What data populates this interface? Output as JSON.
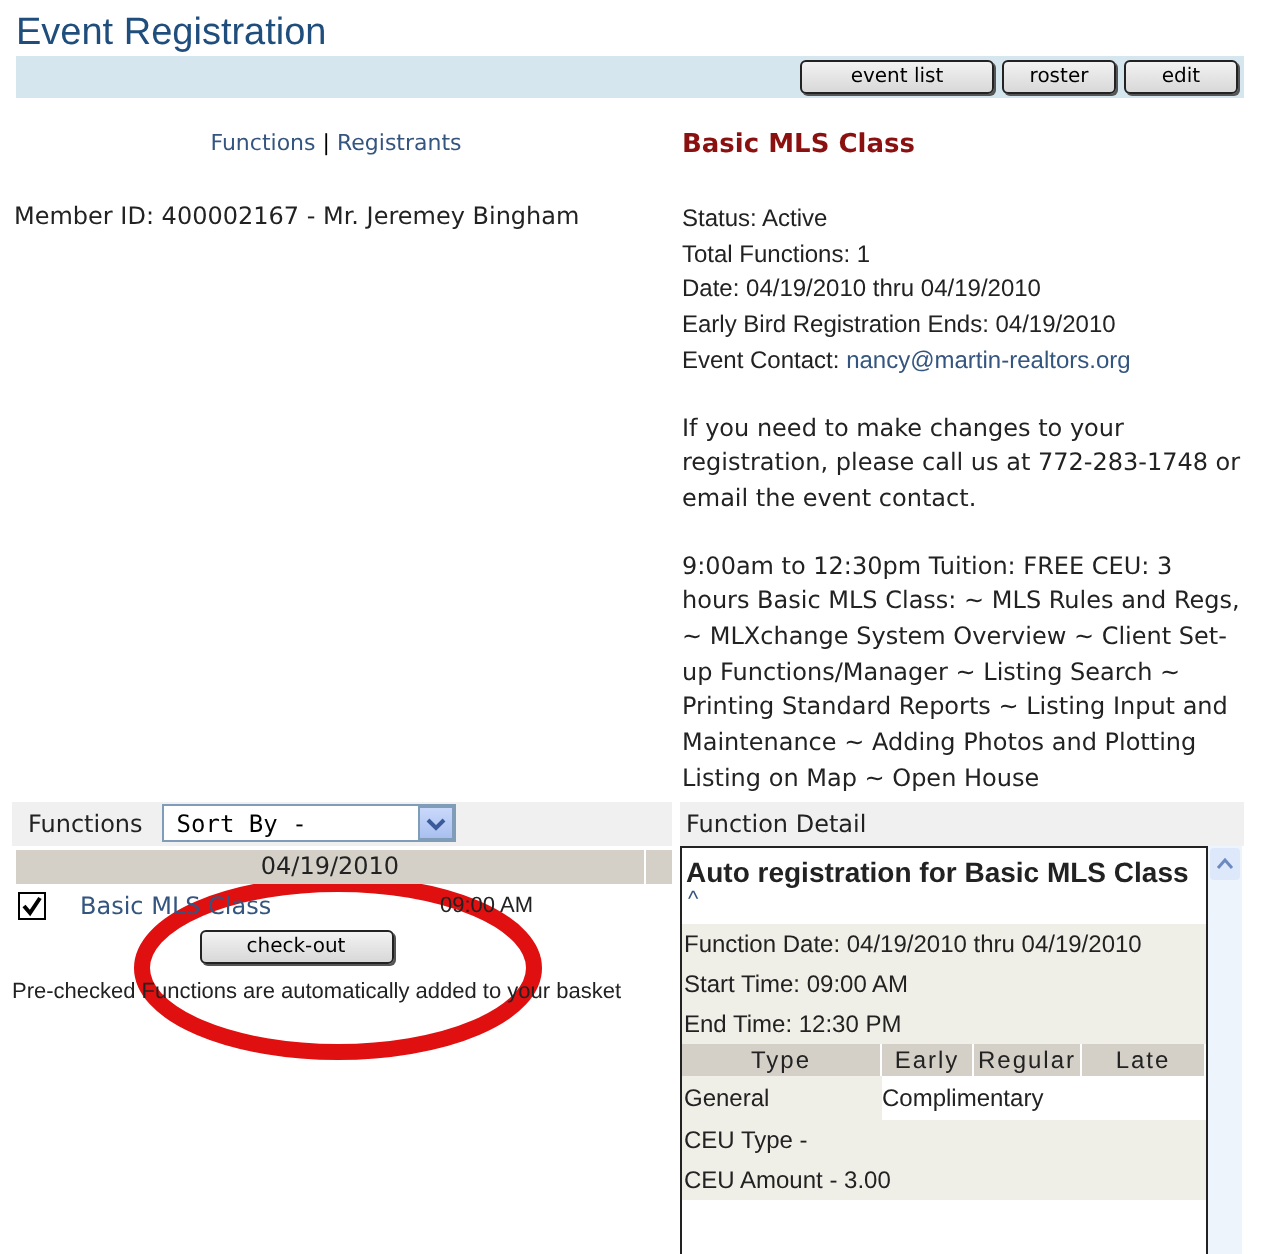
{
  "title": "Event Registration",
  "toolbar": {
    "buttons": [
      "event list",
      "roster",
      "edit"
    ]
  },
  "nav": {
    "links": [
      "Functions",
      "Registrants"
    ],
    "separator": "|"
  },
  "member": "Member ID: 400002167 - Mr. Jeremey Bingham",
  "event": {
    "name": "Basic MLS Class",
    "details": [
      "Status: Active",
      "Total Functions: 1",
      "Date: 04/19/2010 thru 04/19/2010",
      "Early Bird Registration Ends: 04/19/2010"
    ],
    "contact_label": "Event Contact:",
    "contact_email": "nancy@martin-realtors.org",
    "notice": "If you need to make changes to your registration, please call us at 772-283-1748 or email the event contact.",
    "description": "9:00am to 12:30pm Tuition: FREE CEU: 3 hours Basic MLS Class: ~ MLS Rules and Regs, ~ MLXchange System Overview ~ Client Set-up Functions/Manager ~ Listing Search ~ Printing Standard Reports ~ Listing Input and Maintenance ~ Adding Photos and Plotting Listing on Map ~ Open House"
  },
  "functions": {
    "label": "Functions",
    "sort": {
      "value": "Sort By -"
    },
    "date": "04/19/2010",
    "items": [
      {
        "name": "Basic MLS Class",
        "time": "09:00 AM",
        "checked": true
      }
    ],
    "checkout": "check-out",
    "note": "Pre-checked Functions are automatically added to your basket"
  },
  "detail": {
    "label": "Function Detail",
    "title": "Auto registration for Basic MLS Class",
    "caret": "^",
    "lines": [
      "Function Date: 04/19/2010 thru 04/19/2010",
      "Start Time: 09:00 AM",
      "End Time: 12:30 PM"
    ],
    "fee_columns": [
      "Type",
      "Early",
      "Regular",
      "Late"
    ],
    "fee_rows": [
      {
        "type": "General",
        "price": "Complimentary"
      }
    ],
    "ceu": [
      "CEU Type -",
      "CEU Amount - 3.00"
    ]
  }
}
